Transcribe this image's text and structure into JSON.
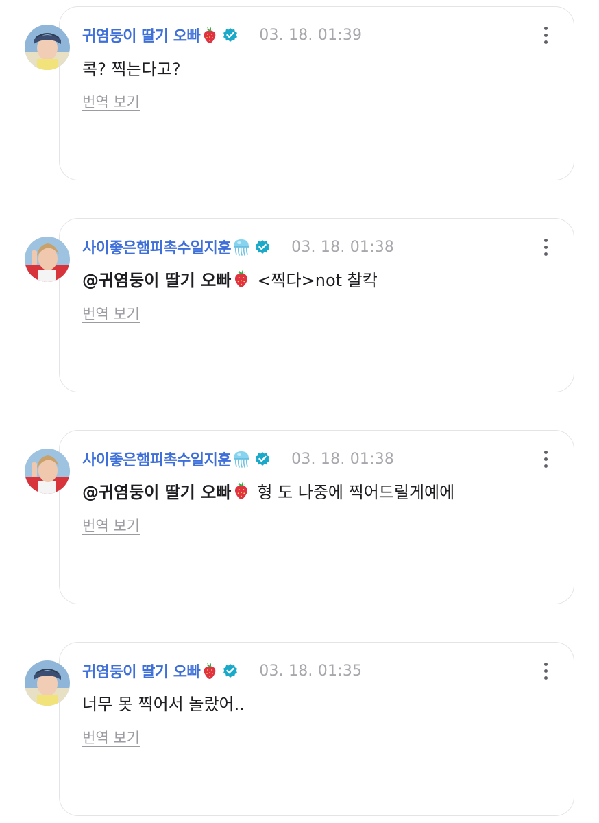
{
  "comments": [
    {
      "author": "귀염둥이 딸기 오빠",
      "author_emoji": "strawberry-icon",
      "verified": true,
      "timestamp": "03. 18. 01:39",
      "mention": "",
      "mention_emoji": "",
      "text": "콕? 찍는다고?",
      "translate_label": "번역 보기"
    },
    {
      "author": "사이좋은햄피촉수일지훈",
      "author_emoji": "jellyfish-icon",
      "verified": true,
      "timestamp": "03. 18. 01:38",
      "mention": "@귀염둥이 딸기 오빠",
      "mention_emoji": "strawberry-icon",
      "text": "<찍다>not 찰칵",
      "translate_label": "번역 보기"
    },
    {
      "author": "사이좋은햄피촉수일지훈",
      "author_emoji": "jellyfish-icon",
      "verified": true,
      "timestamp": "03. 18. 01:38",
      "mention": "@귀염둥이 딸기 오빠",
      "mention_emoji": "strawberry-icon",
      "text": "형 도 나중에 찍어드릴게예에",
      "translate_label": "번역 보기"
    },
    {
      "author": "귀염둥이 딸기 오빠",
      "author_emoji": "strawberry-icon",
      "verified": true,
      "timestamp": "03. 18. 01:35",
      "mention": "",
      "mention_emoji": "",
      "text": "너무 못 찍어서 놀랐어..",
      "translate_label": "번역 보기"
    }
  ],
  "colors": {
    "author_name": "#3f70d9",
    "verified_badge": "#1aa9c8",
    "timestamp": "#a7a7ad",
    "body_text": "#1e1e22",
    "translate_link": "#9b9ba2",
    "card_border": "#e4e4e8"
  }
}
